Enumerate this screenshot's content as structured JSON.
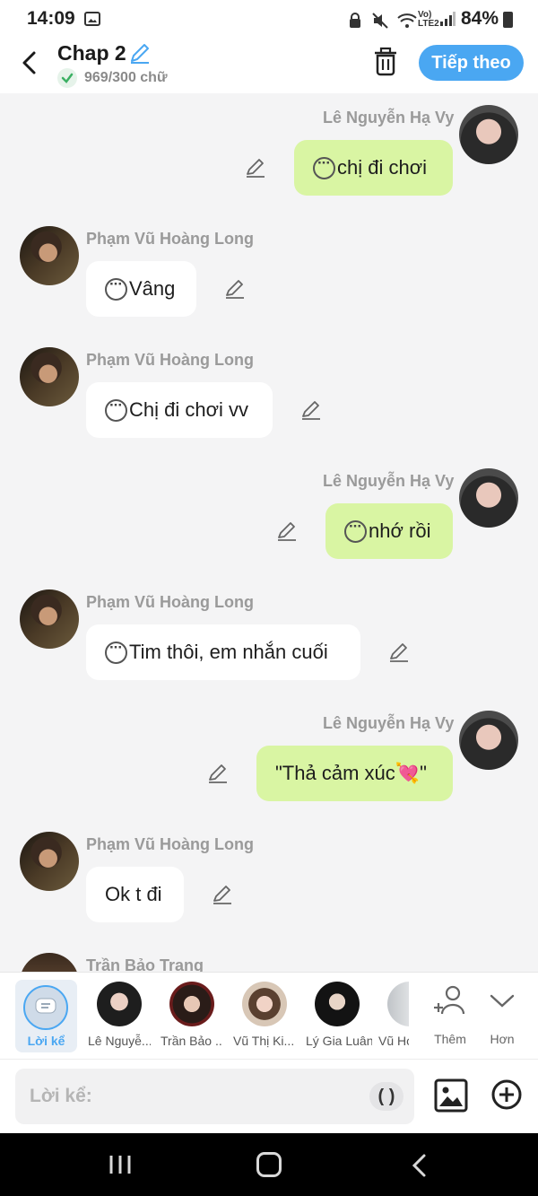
{
  "status_bar": {
    "time": "14:09",
    "network": "Vo) LTE2",
    "battery": "84%",
    "icons": [
      "image-icon",
      "lock-icon",
      "mute-icon",
      "wifi-icon",
      "signal-icon",
      "battery-icon"
    ]
  },
  "header": {
    "title": "Chap 2",
    "word_count": "969/300 chữ",
    "next_label": "Tiếp theo",
    "accent_color": "#4aa7f2"
  },
  "messages": [
    {
      "sender": "Lê Nguyễn Hạ Vy",
      "side": "right",
      "text": "chị đi chơi",
      "thinking": true
    },
    {
      "sender": "Phạm Vũ Hoàng Long",
      "side": "left",
      "text": "Vâng",
      "thinking": true
    },
    {
      "sender": "Phạm Vũ Hoàng Long",
      "side": "left",
      "text": "Chị đi chơi vv",
      "thinking": true
    },
    {
      "sender": "Lê Nguyễn Hạ Vy",
      "side": "right",
      "text": "nhớ rồi",
      "thinking": true
    },
    {
      "sender": "Phạm Vũ Hoàng Long",
      "side": "left",
      "text": "Tim thôi, em nhắn cuối",
      "thinking": true
    },
    {
      "sender": "Lê Nguyễn Hạ Vy",
      "side": "right",
      "text": "\"Thả cảm xúc💘\"",
      "thinking": false
    },
    {
      "sender": "Phạm Vũ Hoàng Long",
      "side": "left",
      "text": "Ok t đi",
      "thinking": false
    },
    {
      "sender": "Trần Bảo Trang",
      "side": "left",
      "text": "",
      "thinking": false
    }
  ],
  "character_bar": {
    "narration_label": "Lời kể",
    "characters": [
      {
        "label": "Lê Nguyễ..."
      },
      {
        "label": "Trần Bảo ..."
      },
      {
        "label": "Vũ Thị Ki..."
      },
      {
        "label": "Lý Gia Luân"
      },
      {
        "label": "Vũ Ho"
      }
    ],
    "add_label": "Thêm",
    "more_label": "Hơn"
  },
  "input": {
    "placeholder": "Lời kể:",
    "paren_label": "( )"
  },
  "colors": {
    "bubble_right": "#d9f5a3",
    "bubble_left": "#ffffff",
    "background": "#f4f4f5"
  }
}
